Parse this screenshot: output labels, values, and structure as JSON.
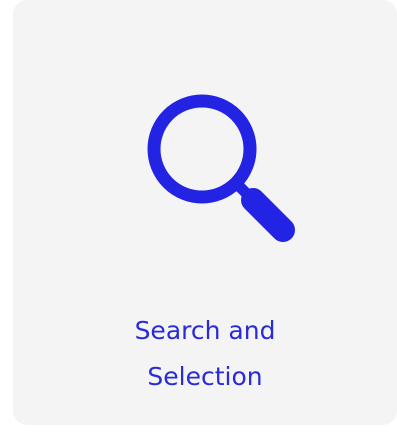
{
  "card": {
    "title_line_1": "Search and",
    "title_line_2": "Selection",
    "icon": "magnifying-glass-icon",
    "accent_color": "#2323e3",
    "text_color": "#2a2ad8"
  }
}
